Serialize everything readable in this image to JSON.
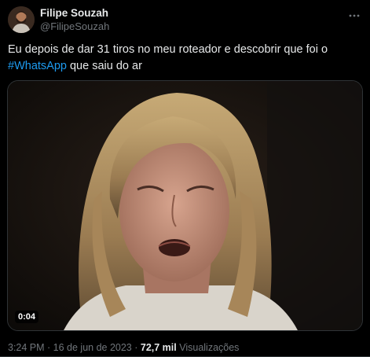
{
  "author": {
    "display_name": "Filipe Souzah",
    "handle": "@FilipeSouzah"
  },
  "tweet": {
    "text_part1": "Eu depois de dar 31 tiros no meu roteador e descobrir que foi o ",
    "hashtag": "#WhatsApp",
    "text_part2": " que saiu do ar"
  },
  "media": {
    "duration": "0:04"
  },
  "meta": {
    "time": "3:24 PM",
    "separator": " · ",
    "date": "16 de jun de 2023",
    "views_count": "72,7 mil",
    "views_label": " Visualizações"
  },
  "icons": {
    "more": "more-horizontal-icon"
  },
  "colors": {
    "background": "#000000",
    "text": "#e7e9ea",
    "secondary": "#71767b",
    "link": "#1d9bf0"
  }
}
